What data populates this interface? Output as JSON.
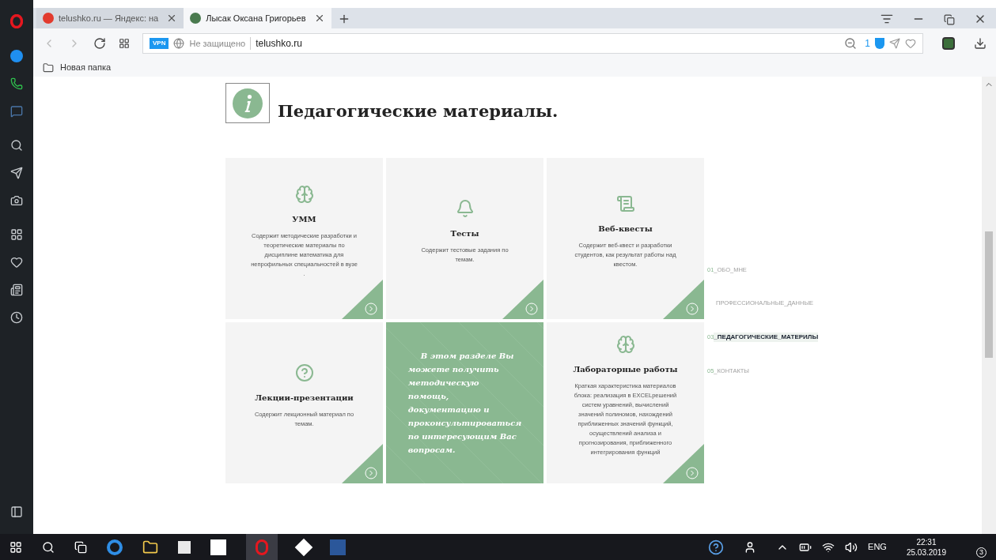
{
  "tabs": [
    {
      "label": "telushko.ru — Яндекс: на",
      "selected": false
    },
    {
      "label": "Лысак Оксана Григорьев",
      "selected": true
    }
  ],
  "address_bar": {
    "vpn": "VPN",
    "security": "Не защищено",
    "url": "telushko.ru",
    "blocked_count": "1"
  },
  "bookmarks": [
    "Новая папка"
  ],
  "page": {
    "heading": "Педагогические материалы.",
    "cards": [
      {
        "kind": "info",
        "title": "УММ",
        "text": "Содержит методические разработки и теоретические материалы по дисциплине математика для непрофильных специальностей в вузе ."
      },
      {
        "kind": "info",
        "title": "Тесты",
        "text": "Содержит тестовые задания по темам."
      },
      {
        "kind": "info",
        "title": "Веб-квесты",
        "text": "Содержит веб-квест и разработки студентов, как результат работы над квестом."
      },
      {
        "kind": "info",
        "title": "Лекции-презентации",
        "text": "Содержит лекционный материал по темам."
      },
      {
        "kind": "promo",
        "text": "В этом разделе Вы можете получить методическую помощь, документацию и проконсультироваться по интересующим Вас вопросам."
      },
      {
        "kind": "info",
        "title": "Лабораторные работы",
        "text": "Краткая характеристика материалов блока: реализация в EXCELрешений систем уравнений, вычислений значений полиномов, нахождений приближенных значений функций, осуществлений анализа и прогнозирования, приближенного интегрирования функций"
      }
    ],
    "section_nav": [
      {
        "number": "01",
        "label": "_ОБО_МНЕ",
        "selected": false
      },
      {
        "label": "ПРОФЕССИОНАЛЬНЫЕ_ДАННЫЕ",
        "selected": false
      },
      {
        "number": "03",
        "label": "_ПЕДАГОГИЧЕСКИЕ_МАТЕРИЛЫ",
        "selected": true
      },
      {
        "number": "05",
        "label": "_КОНТАКТЫ",
        "selected": false
      }
    ]
  },
  "taskbar": {
    "language": "ENG",
    "time": "22:31",
    "date": "25.03.2019",
    "notifications": "3"
  }
}
